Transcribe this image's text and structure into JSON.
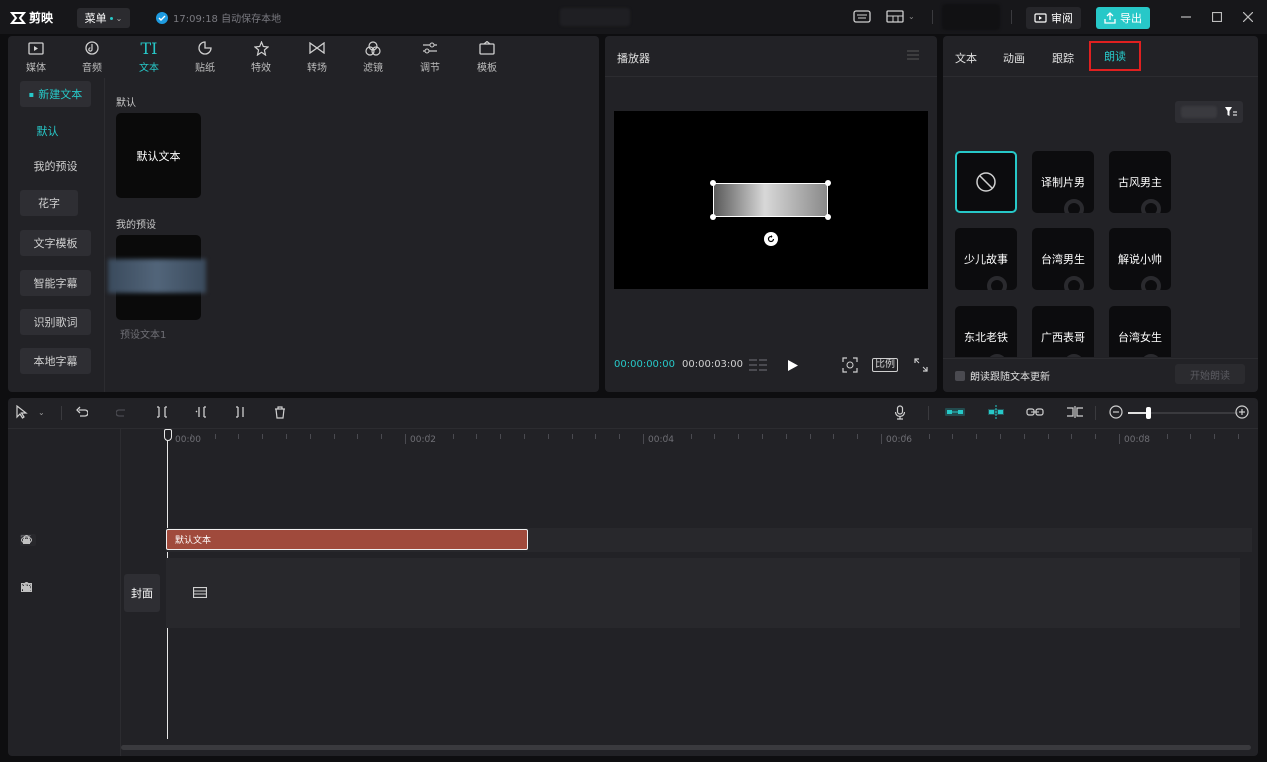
{
  "app": {
    "name": "剪映",
    "menu_label": "菜单",
    "save_status": "17:09:18 自动保存本地",
    "review_label": "审阅",
    "export_label": "导出"
  },
  "toolbar": {
    "tabs": [
      {
        "label": "媒体",
        "icon": "media-icon"
      },
      {
        "label": "音频",
        "icon": "audio-icon"
      },
      {
        "label": "文本",
        "icon": "text-icon"
      },
      {
        "label": "贴纸",
        "icon": "sticker-icon"
      },
      {
        "label": "特效",
        "icon": "effects-icon"
      },
      {
        "label": "转场",
        "icon": "transition-icon"
      },
      {
        "label": "滤镜",
        "icon": "filter-icon"
      },
      {
        "label": "调节",
        "icon": "adjust-icon"
      },
      {
        "label": "模板",
        "icon": "template-icon"
      }
    ],
    "active_tab": "文本"
  },
  "text_sidebar": {
    "items": [
      "新建文本",
      "默认",
      "我的预设",
      "花字",
      "文字模板",
      "智能字幕",
      "识别歌词",
      "本地字幕"
    ]
  },
  "text_content": {
    "default_section": "默认",
    "default_card": "默认文本",
    "preset_section": "我的预设",
    "preset_card": "预设文本1"
  },
  "player": {
    "title": "播放器",
    "current_time": "00:00:00:00",
    "total_time": "00:00:03:00",
    "ratio_label": "比例"
  },
  "props": {
    "tabs": [
      "文本",
      "动画",
      "跟踪",
      "朗读"
    ],
    "active_tab": "朗读",
    "voices": [
      "译制片男",
      "古风男主",
      "少儿故事",
      "台湾男生",
      "解说小帅",
      "东北老铁",
      "广西表哥",
      "台湾女生"
    ],
    "follow_update_label": "朗读跟随文本更新",
    "start_button": "开始朗读"
  },
  "timeline": {
    "ticks": [
      "00:00",
      "00:02",
      "00:04",
      "00:06",
      "00:08"
    ],
    "clip_label": "默认文本",
    "cover_label": "封面"
  },
  "colors": {
    "accent": "#27c8c8",
    "clip": "#a04a3c",
    "highlight_box": "#e02020",
    "export_button": "#27c8c8"
  }
}
